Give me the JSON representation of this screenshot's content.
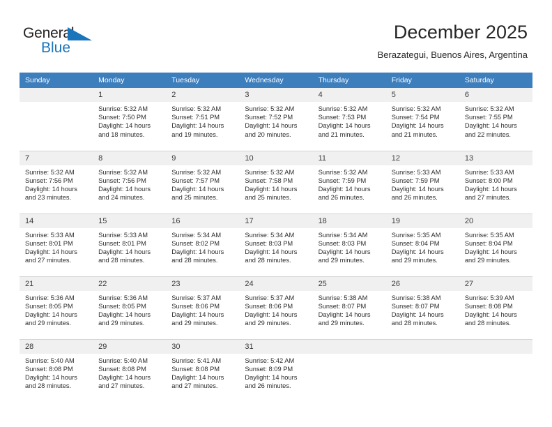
{
  "logo": {
    "word_top": "General",
    "word_bottom": "Blue",
    "triangle_color": "#1b75bb",
    "text_color": "#231f20"
  },
  "header": {
    "title": "December 2025",
    "subtitle": "Berazategui, Buenos Aires, Argentina"
  },
  "theme": {
    "header_bg": "#3d7ebd",
    "header_text": "#ffffff",
    "daynum_bg": "#f0f0f0",
    "cell_border": "#d4d4d4",
    "body_text": "#2c2c2c"
  },
  "weekday_headers": [
    "Sunday",
    "Monday",
    "Tuesday",
    "Wednesday",
    "Thursday",
    "Friday",
    "Saturday"
  ],
  "labels": {
    "sunrise": "Sunrise:",
    "sunset": "Sunset:",
    "daylight": "Daylight:"
  },
  "weeks": [
    [
      {
        "day": "",
        "sunrise": "",
        "sunset": "",
        "daylight_1": "",
        "daylight_2": "",
        "empty": true
      },
      {
        "day": "1",
        "sunrise": "Sunrise: 5:32 AM",
        "sunset": "Sunset: 7:50 PM",
        "daylight_1": "Daylight: 14 hours",
        "daylight_2": "and 18 minutes."
      },
      {
        "day": "2",
        "sunrise": "Sunrise: 5:32 AM",
        "sunset": "Sunset: 7:51 PM",
        "daylight_1": "Daylight: 14 hours",
        "daylight_2": "and 19 minutes."
      },
      {
        "day": "3",
        "sunrise": "Sunrise: 5:32 AM",
        "sunset": "Sunset: 7:52 PM",
        "daylight_1": "Daylight: 14 hours",
        "daylight_2": "and 20 minutes."
      },
      {
        "day": "4",
        "sunrise": "Sunrise: 5:32 AM",
        "sunset": "Sunset: 7:53 PM",
        "daylight_1": "Daylight: 14 hours",
        "daylight_2": "and 21 minutes."
      },
      {
        "day": "5",
        "sunrise": "Sunrise: 5:32 AM",
        "sunset": "Sunset: 7:54 PM",
        "daylight_1": "Daylight: 14 hours",
        "daylight_2": "and 21 minutes."
      },
      {
        "day": "6",
        "sunrise": "Sunrise: 5:32 AM",
        "sunset": "Sunset: 7:55 PM",
        "daylight_1": "Daylight: 14 hours",
        "daylight_2": "and 22 minutes."
      }
    ],
    [
      {
        "day": "7",
        "sunrise": "Sunrise: 5:32 AM",
        "sunset": "Sunset: 7:56 PM",
        "daylight_1": "Daylight: 14 hours",
        "daylight_2": "and 23 minutes."
      },
      {
        "day": "8",
        "sunrise": "Sunrise: 5:32 AM",
        "sunset": "Sunset: 7:56 PM",
        "daylight_1": "Daylight: 14 hours",
        "daylight_2": "and 24 minutes."
      },
      {
        "day": "9",
        "sunrise": "Sunrise: 5:32 AM",
        "sunset": "Sunset: 7:57 PM",
        "daylight_1": "Daylight: 14 hours",
        "daylight_2": "and 25 minutes."
      },
      {
        "day": "10",
        "sunrise": "Sunrise: 5:32 AM",
        "sunset": "Sunset: 7:58 PM",
        "daylight_1": "Daylight: 14 hours",
        "daylight_2": "and 25 minutes."
      },
      {
        "day": "11",
        "sunrise": "Sunrise: 5:32 AM",
        "sunset": "Sunset: 7:59 PM",
        "daylight_1": "Daylight: 14 hours",
        "daylight_2": "and 26 minutes."
      },
      {
        "day": "12",
        "sunrise": "Sunrise: 5:33 AM",
        "sunset": "Sunset: 7:59 PM",
        "daylight_1": "Daylight: 14 hours",
        "daylight_2": "and 26 minutes."
      },
      {
        "day": "13",
        "sunrise": "Sunrise: 5:33 AM",
        "sunset": "Sunset: 8:00 PM",
        "daylight_1": "Daylight: 14 hours",
        "daylight_2": "and 27 minutes."
      }
    ],
    [
      {
        "day": "14",
        "sunrise": "Sunrise: 5:33 AM",
        "sunset": "Sunset: 8:01 PM",
        "daylight_1": "Daylight: 14 hours",
        "daylight_2": "and 27 minutes."
      },
      {
        "day": "15",
        "sunrise": "Sunrise: 5:33 AM",
        "sunset": "Sunset: 8:01 PM",
        "daylight_1": "Daylight: 14 hours",
        "daylight_2": "and 28 minutes."
      },
      {
        "day": "16",
        "sunrise": "Sunrise: 5:34 AM",
        "sunset": "Sunset: 8:02 PM",
        "daylight_1": "Daylight: 14 hours",
        "daylight_2": "and 28 minutes."
      },
      {
        "day": "17",
        "sunrise": "Sunrise: 5:34 AM",
        "sunset": "Sunset: 8:03 PM",
        "daylight_1": "Daylight: 14 hours",
        "daylight_2": "and 28 minutes."
      },
      {
        "day": "18",
        "sunrise": "Sunrise: 5:34 AM",
        "sunset": "Sunset: 8:03 PM",
        "daylight_1": "Daylight: 14 hours",
        "daylight_2": "and 29 minutes."
      },
      {
        "day": "19",
        "sunrise": "Sunrise: 5:35 AM",
        "sunset": "Sunset: 8:04 PM",
        "daylight_1": "Daylight: 14 hours",
        "daylight_2": "and 29 minutes."
      },
      {
        "day": "20",
        "sunrise": "Sunrise: 5:35 AM",
        "sunset": "Sunset: 8:04 PM",
        "daylight_1": "Daylight: 14 hours",
        "daylight_2": "and 29 minutes."
      }
    ],
    [
      {
        "day": "21",
        "sunrise": "Sunrise: 5:36 AM",
        "sunset": "Sunset: 8:05 PM",
        "daylight_1": "Daylight: 14 hours",
        "daylight_2": "and 29 minutes."
      },
      {
        "day": "22",
        "sunrise": "Sunrise: 5:36 AM",
        "sunset": "Sunset: 8:05 PM",
        "daylight_1": "Daylight: 14 hours",
        "daylight_2": "and 29 minutes."
      },
      {
        "day": "23",
        "sunrise": "Sunrise: 5:37 AM",
        "sunset": "Sunset: 8:06 PM",
        "daylight_1": "Daylight: 14 hours",
        "daylight_2": "and 29 minutes."
      },
      {
        "day": "24",
        "sunrise": "Sunrise: 5:37 AM",
        "sunset": "Sunset: 8:06 PM",
        "daylight_1": "Daylight: 14 hours",
        "daylight_2": "and 29 minutes."
      },
      {
        "day": "25",
        "sunrise": "Sunrise: 5:38 AM",
        "sunset": "Sunset: 8:07 PM",
        "daylight_1": "Daylight: 14 hours",
        "daylight_2": "and 29 minutes."
      },
      {
        "day": "26",
        "sunrise": "Sunrise: 5:38 AM",
        "sunset": "Sunset: 8:07 PM",
        "daylight_1": "Daylight: 14 hours",
        "daylight_2": "and 28 minutes."
      },
      {
        "day": "27",
        "sunrise": "Sunrise: 5:39 AM",
        "sunset": "Sunset: 8:08 PM",
        "daylight_1": "Daylight: 14 hours",
        "daylight_2": "and 28 minutes."
      }
    ],
    [
      {
        "day": "28",
        "sunrise": "Sunrise: 5:40 AM",
        "sunset": "Sunset: 8:08 PM",
        "daylight_1": "Daylight: 14 hours",
        "daylight_2": "and 28 minutes."
      },
      {
        "day": "29",
        "sunrise": "Sunrise: 5:40 AM",
        "sunset": "Sunset: 8:08 PM",
        "daylight_1": "Daylight: 14 hours",
        "daylight_2": "and 27 minutes."
      },
      {
        "day": "30",
        "sunrise": "Sunrise: 5:41 AM",
        "sunset": "Sunset: 8:08 PM",
        "daylight_1": "Daylight: 14 hours",
        "daylight_2": "and 27 minutes."
      },
      {
        "day": "31",
        "sunrise": "Sunrise: 5:42 AM",
        "sunset": "Sunset: 8:09 PM",
        "daylight_1": "Daylight: 14 hours",
        "daylight_2": "and 26 minutes."
      },
      {
        "day": "",
        "sunrise": "",
        "sunset": "",
        "daylight_1": "",
        "daylight_2": "",
        "empty": true
      },
      {
        "day": "",
        "sunrise": "",
        "sunset": "",
        "daylight_1": "",
        "daylight_2": "",
        "empty": true
      },
      {
        "day": "",
        "sunrise": "",
        "sunset": "",
        "daylight_1": "",
        "daylight_2": "",
        "empty": true
      }
    ]
  ]
}
